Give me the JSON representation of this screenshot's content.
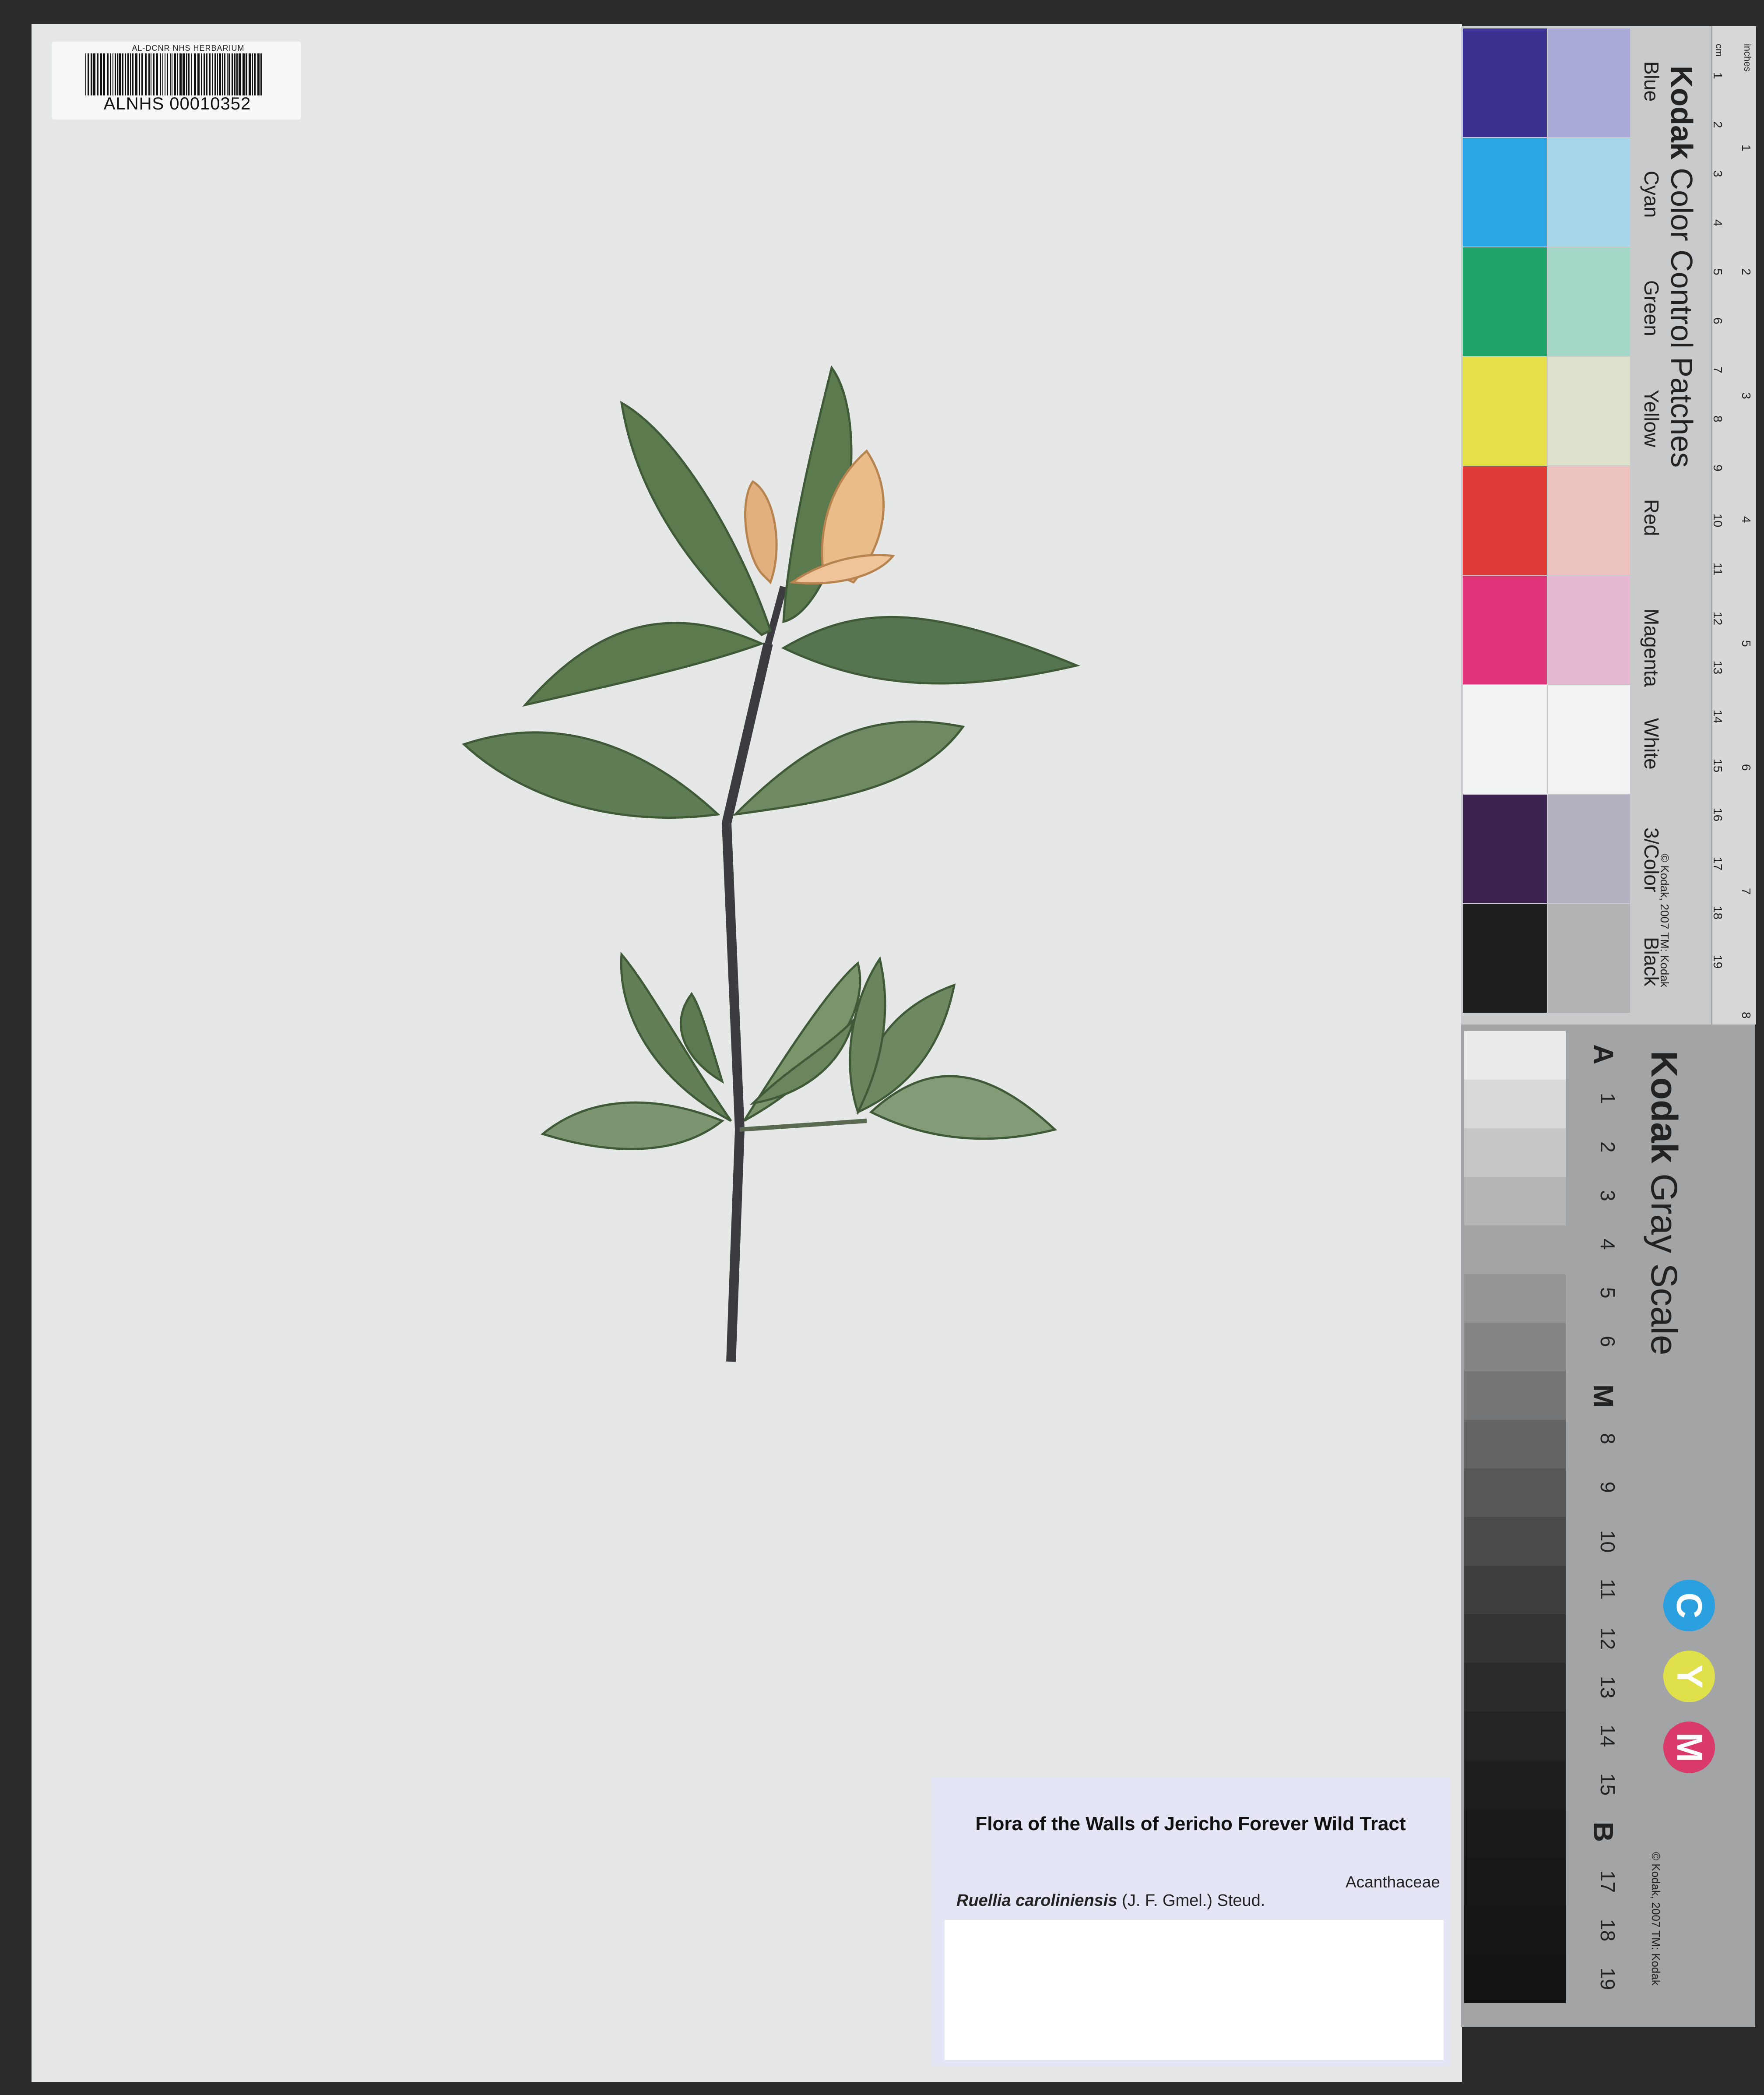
{
  "barcode": {
    "institution_text": "AL-DCNR NHS HERBARIUM",
    "catalog_number": "ALNHS 00010352"
  },
  "label": {
    "title": "Flora of  the Walls of Jericho Forever Wild Tract",
    "family": "Acanthaceae",
    "taxon_name": "Ruellia caroliniensis",
    "taxon_authority": "(J. F. Gmel.) Steud."
  },
  "color_card": {
    "brand": "Kodak",
    "title": "Color Control Patches",
    "copyright": "© Kodak, 2007  TM: Kodak",
    "patches": [
      {
        "label": "Blue",
        "dark": "#3b3190",
        "light": "#a9aad6"
      },
      {
        "label": "Cyan",
        "dark": "#2aa8e6",
        "light": "#a8d6ea"
      },
      {
        "label": "Green",
        "dark": "#1fa36a",
        "light": "#a5d7c9"
      },
      {
        "label": "Yellow",
        "dark": "#e6df48",
        "light": "#dde2cd"
      },
      {
        "label": "Red",
        "dark": "#e03a36",
        "light": "#ecc2be"
      },
      {
        "label": "Magenta",
        "dark": "#e0357a",
        "light": "#e5b9d1"
      },
      {
        "label": "White",
        "dark": "#f1f2f2",
        "light": "#f1f2f2"
      },
      {
        "label": "3/Color",
        "dark": "#3b2550",
        "light": "#b3b2c0"
      },
      {
        "label": "Black",
        "dark": "#1e1e1e",
        "light": "#b1b2b2"
      }
    ],
    "ruler_units": [
      "cm",
      "inches"
    ],
    "ruler_cm": [
      "1",
      "2",
      "3",
      "4",
      "5",
      "6",
      "7",
      "8",
      "9",
      "10",
      "11",
      "12",
      "13",
      "14",
      "15",
      "16",
      "17",
      "18",
      "19"
    ],
    "ruler_inches": [
      "1",
      "2",
      "3",
      "4",
      "5",
      "6",
      "7",
      "8"
    ]
  },
  "gray_card": {
    "brand": "Kodak",
    "title": "Gray Scale",
    "copyright": "© Kodak, 2007  TM: Kodak",
    "steps": [
      "A",
      "1",
      "2",
      "3",
      "4",
      "5",
      "6",
      "M",
      "8",
      "9",
      "10",
      "11",
      "12",
      "13",
      "14",
      "15",
      "B",
      "17",
      "18",
      "19"
    ],
    "step_colors": [
      "#ebebeb",
      "#d9d9da",
      "#c7c7c8",
      "#b5b5b6",
      "#a3a4a5",
      "#949596",
      "#848586",
      "#747576",
      "#656566",
      "#575758",
      "#4a4a4b",
      "#3e3e3f",
      "#343435",
      "#2b2b2c",
      "#242425",
      "#1f1f20",
      "#1b1b1c",
      "#181818",
      "#161616",
      "#141414"
    ],
    "cym": [
      {
        "letter": "C",
        "color": "#2aa0e0"
      },
      {
        "letter": "Y",
        "color": "#dfe04a"
      },
      {
        "letter": "M",
        "color": "#d93a6a"
      }
    ]
  }
}
